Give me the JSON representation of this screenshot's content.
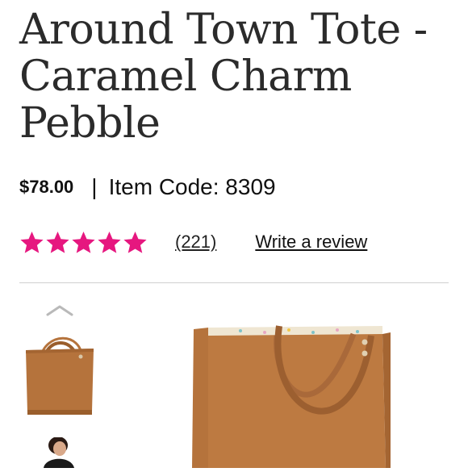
{
  "product": {
    "title": "Around Town Tote - Caramel Charm Pebble",
    "price": "$78.00",
    "separator": "|",
    "item_code_text": "Item Code: 8309",
    "rating": {
      "stars_filled": 5,
      "stars_total": 5,
      "review_count_text": "(221)",
      "write_review_label": "Write a review"
    }
  },
  "colors": {
    "star": "#e6177f",
    "caramel": "#b5733c",
    "text": "#2b2b2b",
    "divider": "#cfcfcf"
  },
  "icons": {
    "gallery_up": "chevron-up-icon",
    "star": "star-icon"
  }
}
